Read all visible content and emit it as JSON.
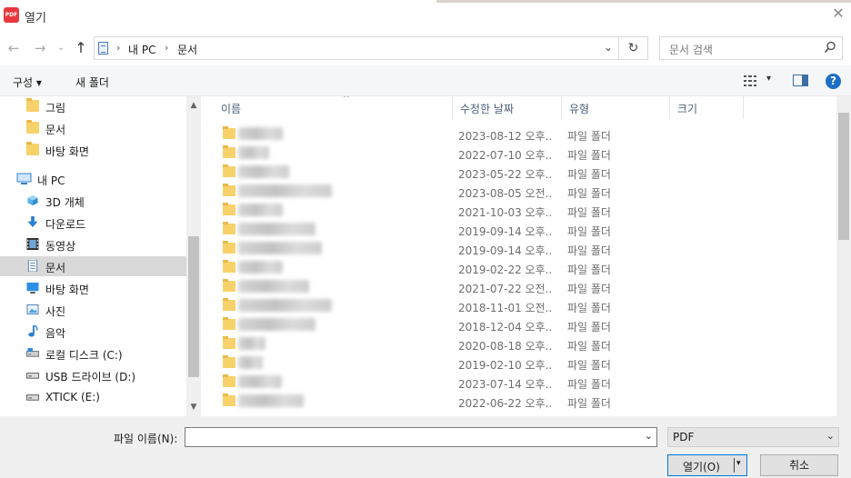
{
  "window": {
    "title": "열기",
    "app_icon_text": "PDF",
    "close_glyph": "✕"
  },
  "nav": {
    "back_glyph": "←",
    "forward_glyph": "→",
    "recent_glyph": "⌄",
    "up_glyph": "↑",
    "breadcrumb": [
      "내 PC",
      "문서"
    ],
    "breadcrumb_sep": "›",
    "address_dropdown_glyph": "⌄",
    "refresh_glyph": "↻",
    "search_placeholder": "문서 검색"
  },
  "toolbar": {
    "organize_label": "구성 ▾",
    "new_folder_label": "새 폴더",
    "help_glyph": "?",
    "view_dropdown_glyph": "▾"
  },
  "sidebar": {
    "items": [
      {
        "label": "그림",
        "icon": "folder-icon"
      },
      {
        "label": "문서",
        "icon": "folder-icon"
      },
      {
        "label": "바탕 화면",
        "icon": "folder-icon"
      },
      {
        "label": "내 PC",
        "icon": "computer-icon"
      },
      {
        "label": "3D 개체",
        "icon": "cube-3d-icon"
      },
      {
        "label": "다운로드",
        "icon": "download-icon"
      },
      {
        "label": "동영상",
        "icon": "video-icon"
      },
      {
        "label": "문서",
        "icon": "documents-icon",
        "selected": true
      },
      {
        "label": "바탕 화면",
        "icon": "desktop-icon"
      },
      {
        "label": "사진",
        "icon": "pictures-icon"
      },
      {
        "label": "음악",
        "icon": "music-icon"
      },
      {
        "label": "로컬 디스크 (C:)",
        "icon": "drive-icon"
      },
      {
        "label": "USB 드라이브 (D:)",
        "icon": "usb-drive-icon"
      },
      {
        "label": "XTICK (E:)",
        "icon": "usb-drive-icon"
      }
    ],
    "scroll_up_glyph": "▲",
    "scroll_down_glyph": "▼"
  },
  "filelist": {
    "columns": [
      "이름",
      "수정한 날짜",
      "유형",
      "크기"
    ],
    "sort_glyph": "^",
    "rows": [
      {
        "date": "2023-08-12 오후...",
        "type": "파일 폴더"
      },
      {
        "date": "2022-07-10 오후...",
        "type": "파일 폴더"
      },
      {
        "date": "2023-05-22 오후...",
        "type": "파일 폴더"
      },
      {
        "date": "2023-08-05 오전...",
        "type": "파일 폴더"
      },
      {
        "date": "2021-10-03 오후...",
        "type": "파일 폴더"
      },
      {
        "date": "2019-09-14 오후...",
        "type": "파일 폴더"
      },
      {
        "date": "2019-09-14 오후...",
        "type": "파일 폴더"
      },
      {
        "date": "2019-02-22 오후...",
        "type": "파일 폴더"
      },
      {
        "date": "2021-07-22 오전...",
        "type": "파일 폴더"
      },
      {
        "date": "2018-11-01 오전...",
        "type": "파일 폴더"
      },
      {
        "date": "2018-12-04 오후...",
        "type": "파일 폴더"
      },
      {
        "date": "2020-08-18 오후...",
        "type": "파일 폴더"
      },
      {
        "date": "2019-02-10 오후...",
        "type": "파일 폴더"
      },
      {
        "date": "2023-07-14 오후...",
        "type": "파일 폴더"
      },
      {
        "date": "2022-06-22 오후...",
        "type": "파일 폴더"
      }
    ]
  },
  "bottom": {
    "filename_label": "파일 이름(N):",
    "filename_value": "",
    "filetype_value": "PDF",
    "dropdown_glyph": "⌄",
    "open_label": "열기(O)",
    "open_split_glyph": "▾",
    "cancel_label": "취소"
  }
}
